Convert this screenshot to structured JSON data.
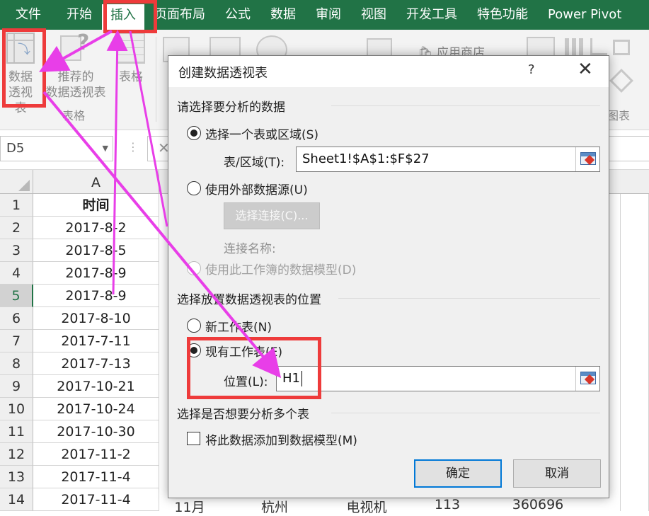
{
  "ribbon_tabs": [
    "文件",
    "开始",
    "插入",
    "页面布局",
    "公式",
    "数据",
    "审阅",
    "视图",
    "开发工具",
    "特色功能",
    "Power Pivot"
  ],
  "active_tab": "插入",
  "ribbon": {
    "pivot_table_btn": [
      "数据",
      "透视表"
    ],
    "recommended_pivot_btn": [
      "推荐的",
      "数据透视表"
    ],
    "table_btn": "表格",
    "group_tables": "表格",
    "app_store": "应用商店",
    "group_charts_partial": "图表"
  },
  "name_box": "D5",
  "column_header": "A",
  "rows": [
    {
      "num": "1",
      "a": "时间"
    },
    {
      "num": "2",
      "a": "2017-8-2"
    },
    {
      "num": "3",
      "a": "2017-8-5"
    },
    {
      "num": "4",
      "a": "2017-8-9"
    },
    {
      "num": "5",
      "a": "2017-8-9"
    },
    {
      "num": "6",
      "a": "2017-8-10"
    },
    {
      "num": "7",
      "a": "2017-7-11"
    },
    {
      "num": "8",
      "a": "2017-7-13"
    },
    {
      "num": "9",
      "a": "2017-10-21"
    },
    {
      "num": "10",
      "a": "2017-10-24"
    },
    {
      "num": "11",
      "a": "2017-10-30"
    },
    {
      "num": "12",
      "a": "2017-11-2"
    },
    {
      "num": "13",
      "a": "2017-11-4"
    },
    {
      "num": "14",
      "a": "2017-11-4"
    }
  ],
  "row14_others": [
    "11月",
    "杭州",
    "电视机",
    "113",
    "360696"
  ],
  "dialog": {
    "title": "创建数据透视表",
    "help": "?",
    "close": "✕",
    "section1": "请选择要分析的数据",
    "opt_table_range": "选择一个表或区域(S)",
    "range_label": "表/区域(T):",
    "range_value": "Sheet1!$A$1:$F$27",
    "opt_external": "使用外部数据源(U)",
    "choose_conn": "选择连接(C)...",
    "conn_name": "连接名称:",
    "opt_data_model": "使用此工作簿的数据模型(D)",
    "section2": "选择放置数据透视表的位置",
    "opt_new_sheet": "新工作表(N)",
    "opt_existing_sheet": "现有工作表(E)",
    "location_label": "位置(L):",
    "location_value": "H1",
    "section3": "选择是否想要分析多个表",
    "add_to_model": "将此数据添加到数据模型(M)",
    "ok": "确定",
    "cancel": "取消"
  },
  "colors": {
    "excel_green": "#217346",
    "highlight_red": "#ee3b3b",
    "arrow_magenta": "#e83ee8"
  }
}
